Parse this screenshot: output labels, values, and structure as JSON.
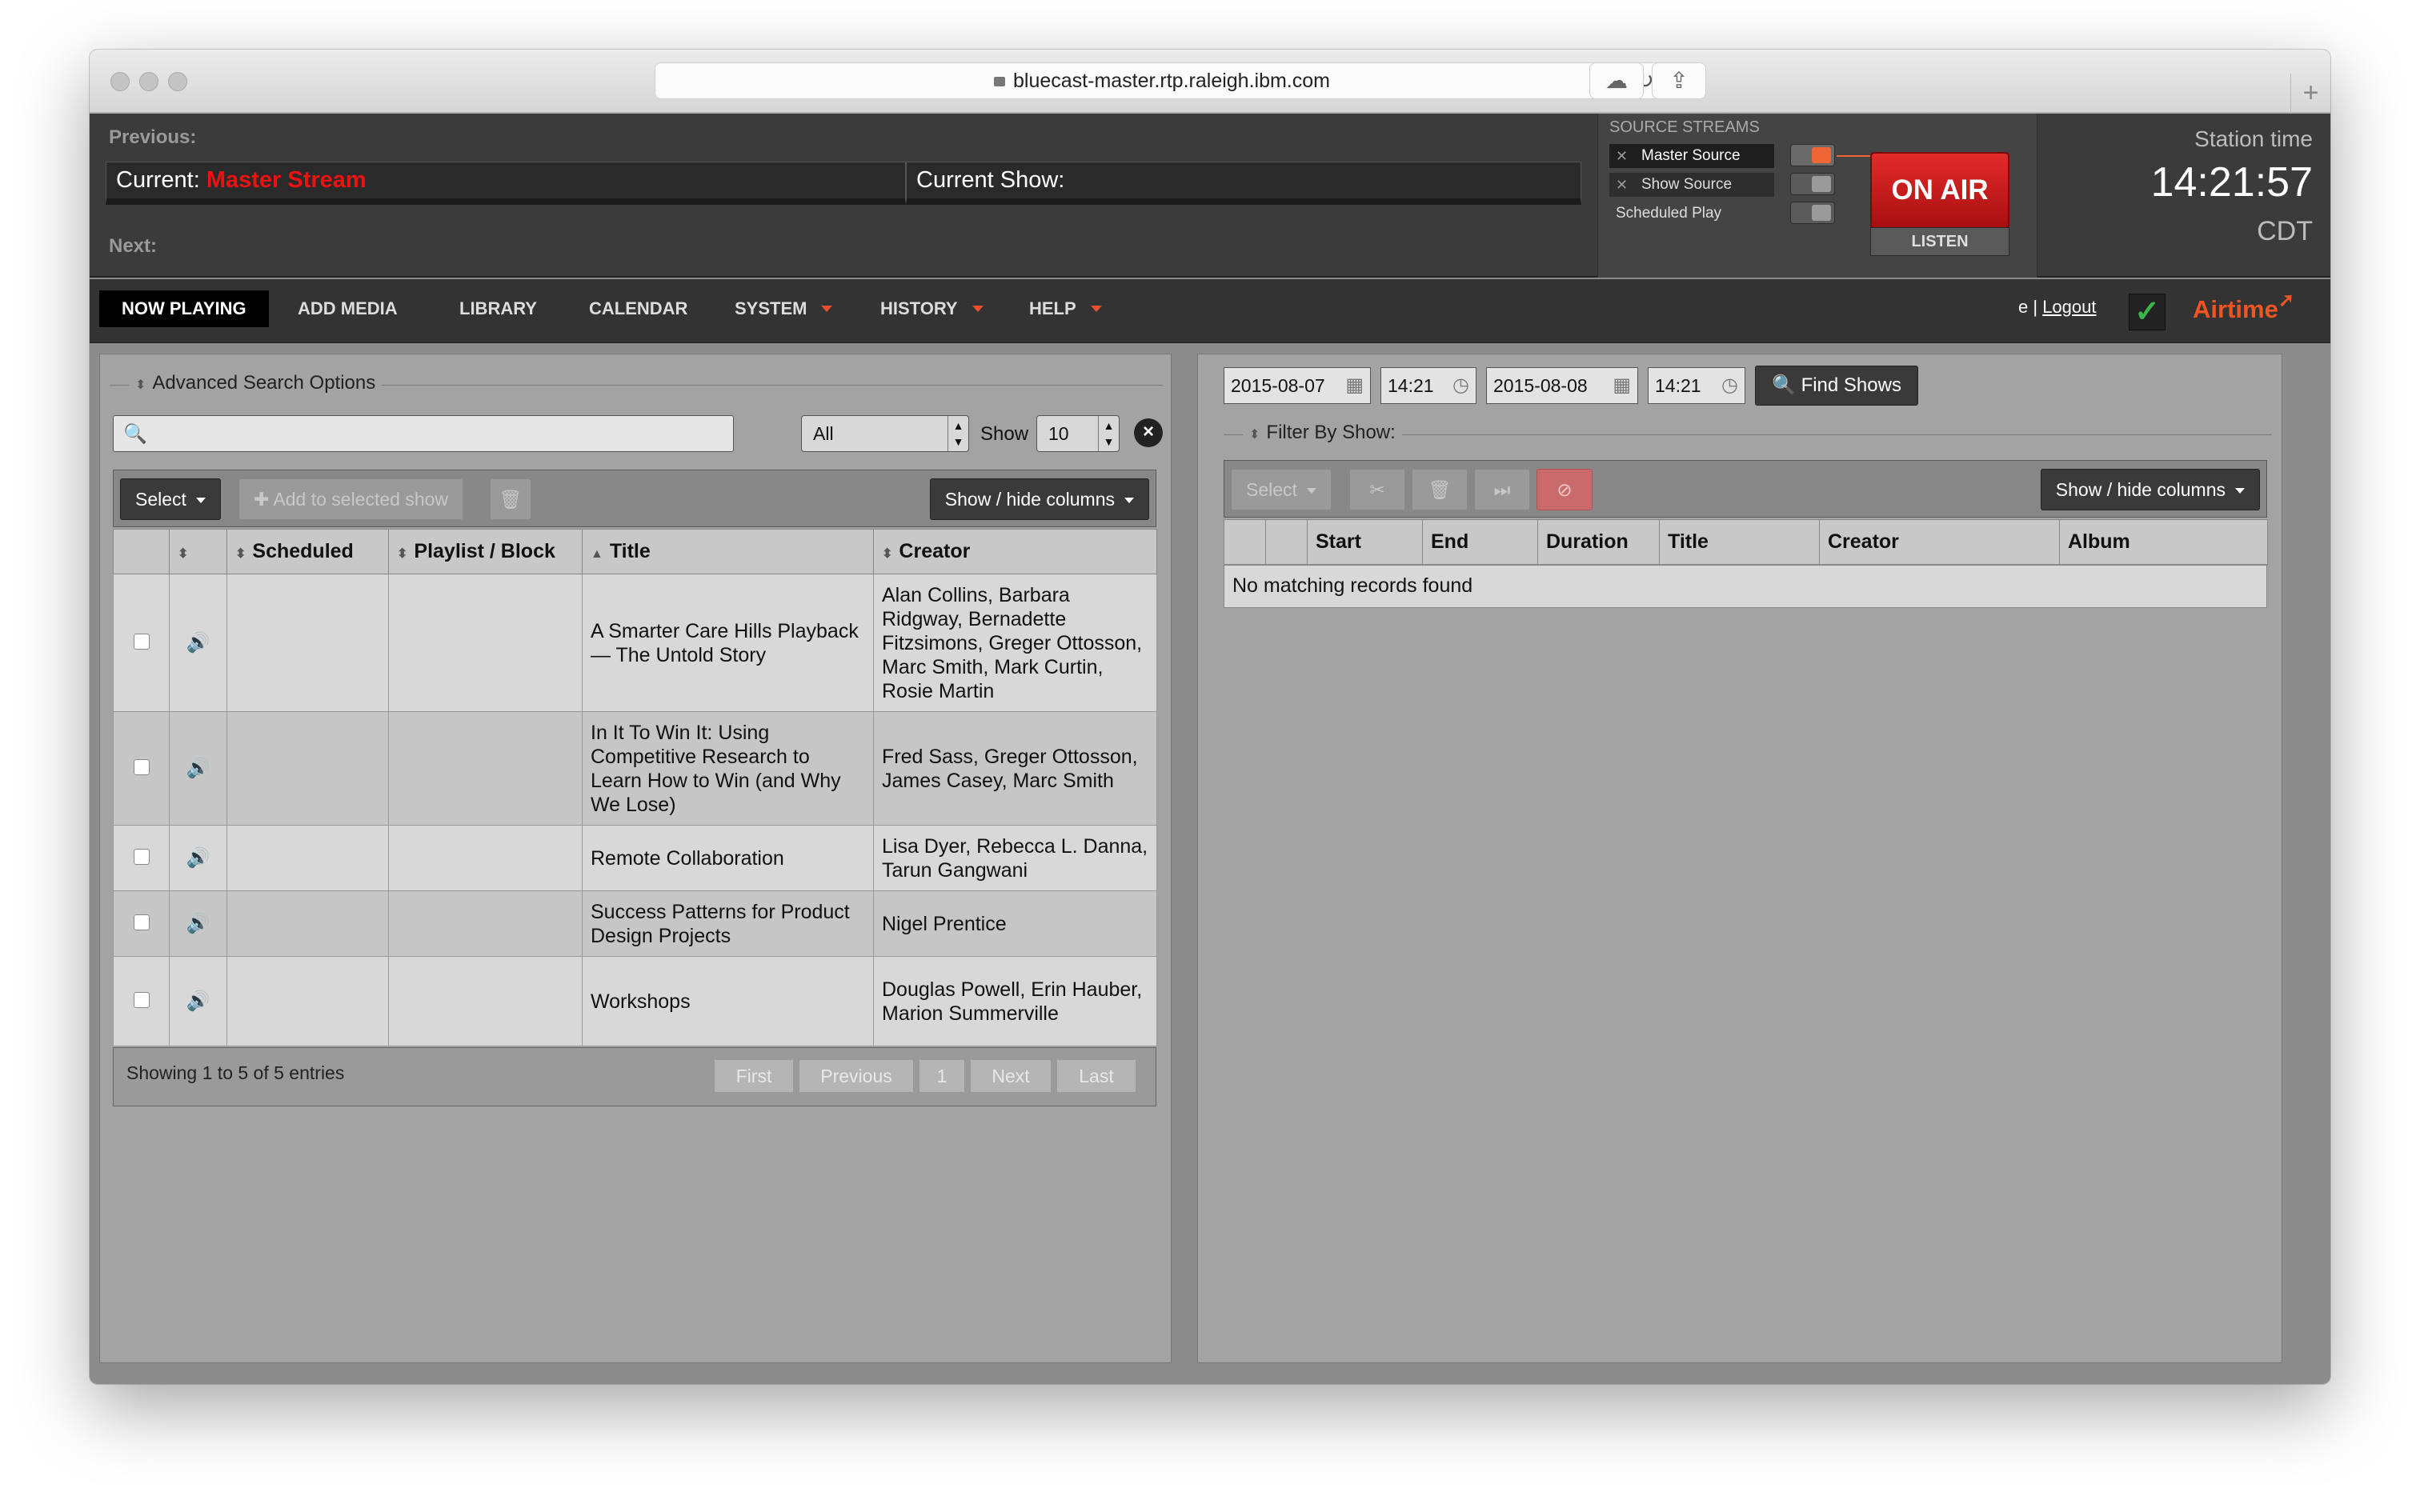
{
  "browser": {
    "url": "bluecast-master.rtp.raleigh.ibm.com"
  },
  "header": {
    "previous_label": "Previous:",
    "next_label": "Next:",
    "current_label": "Current:",
    "current_value": "Master Stream",
    "current_show_label": "Current Show:",
    "source_streams_title": "SOURCE STREAMS",
    "sources": [
      "Master Source",
      "Show Source",
      "Scheduled Play"
    ],
    "on_air_label": "ON AIR",
    "listen_label": "LISTEN",
    "station_time_label": "Station time",
    "station_time": "14:21:57",
    "timezone": "CDT"
  },
  "nav": {
    "items": [
      "NOW PLAYING",
      "ADD MEDIA",
      "LIBRARY",
      "CALENDAR",
      "SYSTEM",
      "HISTORY",
      "HELP"
    ],
    "user_text": "e | ",
    "logout": "Logout",
    "brand": "Airtime",
    "accent_color": "#e84f2f"
  },
  "left": {
    "advanced_search_label": "Advanced Search Options",
    "search_placeholder": "",
    "filter_value": "All",
    "show_label": "Show",
    "show_count": "10",
    "select_label": "Select",
    "add_label": "Add to selected show",
    "showhide_label": "Show / hide columns",
    "columns": [
      "Scheduled",
      "Playlist / Block",
      "Title",
      "Creator"
    ],
    "rows": [
      {
        "title": "A Smarter Care Hills Playback — The Untold Story",
        "creator": "Alan Collins, Barbara Ridgway, Bernadette Fitzsimons, Greger Ottosson, Marc Smith, Mark Curtin, Rosie Martin"
      },
      {
        "title": "In It To Win It: Using Competitive Research to Learn How to Win (and Why We Lose)",
        "creator": "Fred Sass, Greger Ottosson, James Casey, Marc Smith"
      },
      {
        "title": "Remote Collaboration",
        "creator": "Lisa Dyer, Rebecca L. Danna, Tarun Gangwani"
      },
      {
        "title": "Success Patterns for Product Design Projects",
        "creator": "Nigel Prentice"
      },
      {
        "title": "Workshops",
        "creator": "Douglas Powell, Erin Hauber, Marion Summerville"
      }
    ],
    "footer_info": "Showing 1 to 5 of 5 entries",
    "pager": [
      "First",
      "Previous",
      "1",
      "Next",
      "Last"
    ]
  },
  "right": {
    "start_date": "2015-08-07",
    "start_time": "14:21",
    "end_date": "2015-08-08",
    "end_time": "14:21",
    "find_label": "Find Shows",
    "filter_label": "Filter By Show:",
    "select_label": "Select",
    "showhide_label": "Show / hide columns",
    "columns": [
      "Start",
      "End",
      "Duration",
      "Title",
      "Creator",
      "Album"
    ],
    "empty_text": "No matching records found"
  }
}
